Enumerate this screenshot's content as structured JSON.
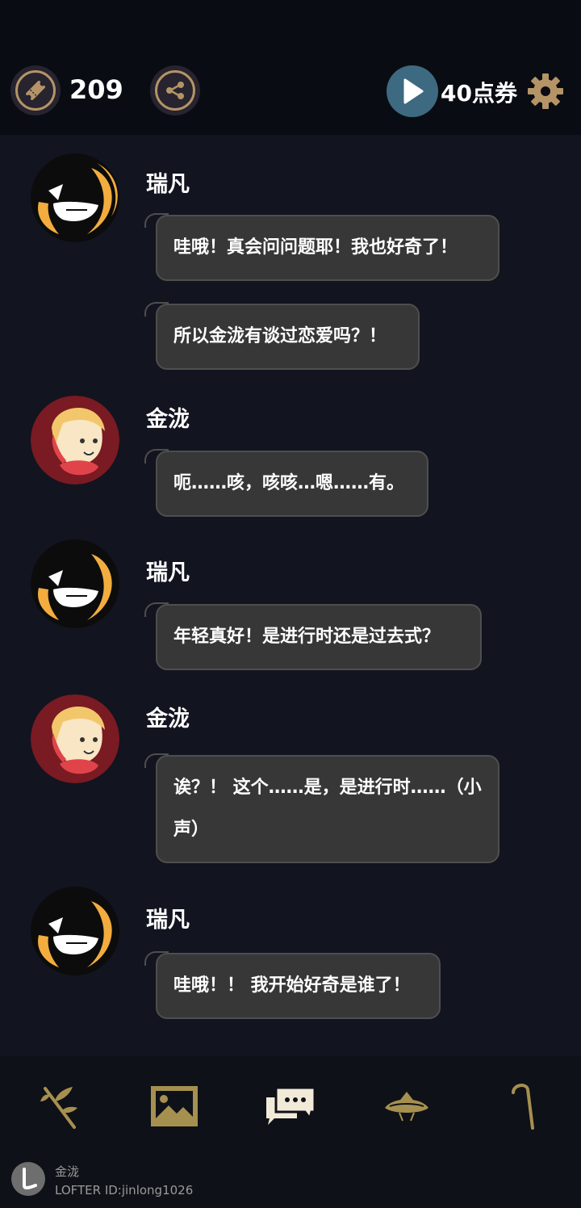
{
  "header": {
    "ticket_count": "209",
    "points_label": "40点券",
    "icons": [
      "ticket-icon",
      "share-icon",
      "play-icon",
      "gear-icon"
    ],
    "accent_color": "#b49466"
  },
  "messages": [
    {
      "speaker": "瑞凡",
      "lines": [
        "哇哦！真会问问题耶！我也好奇了！",
        "所以金泷有谈过恋爱吗？！"
      ]
    },
    {
      "speaker": "金泷",
      "lines": [
        "呃……咳，咳咳…嗯……有。"
      ]
    },
    {
      "speaker": "瑞凡",
      "lines": [
        "年轻真好！是进行时还是过去式？"
      ]
    },
    {
      "speaker": "金泷",
      "lines": [
        "诶？！ 这个……是，是进行时……（小声）"
      ]
    },
    {
      "speaker": "瑞凡",
      "lines": [
        "哇哦！！ 我开始好奇是谁了！"
      ]
    }
  ],
  "bottom_nav": {
    "items": [
      "branch-icon",
      "gallery-icon",
      "chat-icon",
      "hat-icon",
      "cane-icon"
    ],
    "active": "chat-icon"
  },
  "watermark": {
    "name": "金泷",
    "id": "LOFTER ID:jinlong1026"
  }
}
